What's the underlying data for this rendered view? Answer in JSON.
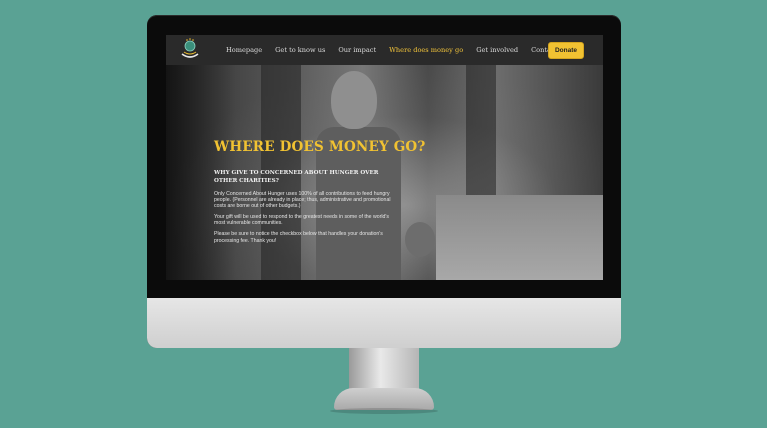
{
  "nav": {
    "links": [
      "Homepage",
      "Get to know us",
      "Our impact",
      "Where does money go",
      "Get involved",
      "Contact"
    ],
    "active_index": 3,
    "donate_label": "Donate"
  },
  "hero": {
    "title": "WHERE DOES MONEY GO?",
    "subtitle": "WHY GIVE TO CONCERNED ABOUT HUNGER OVER OTHER CHARITIES?",
    "paragraphs": [
      "Only Concerned About Hunger uses 100% of all contributions to feed hungry people. (Personnel are already in place; thus, administrative and promotional costs are borne out of other budgets.)",
      "Your gift will be used to respond to the greatest needs in some of the world's most vulnerable communities.",
      "Please be sure to notice the checkbox below that handles your donation's processing fee. Thank you!"
    ]
  },
  "colors": {
    "background": "#5aa294",
    "accent": "#f1c232",
    "nav_background": "#2a2a2a"
  }
}
